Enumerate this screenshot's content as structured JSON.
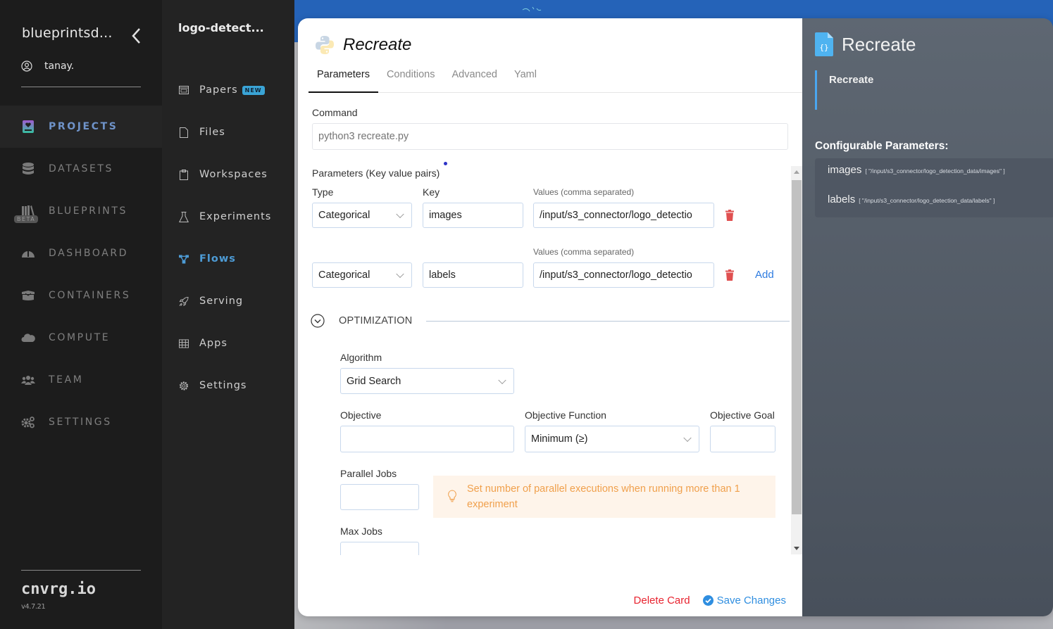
{
  "sidebar": {
    "org_name": "blueprintsd...",
    "user_name": "tanay.",
    "items": [
      {
        "label": "PROJECTS",
        "icon": "projects-icon",
        "active": true
      },
      {
        "label": "DATASETS",
        "icon": "datasets-icon"
      },
      {
        "label": "BLUEPRINTS",
        "icon": "blueprints-icon",
        "badge": "BETA"
      },
      {
        "label": "DASHBOARD",
        "icon": "dashboard-icon"
      },
      {
        "label": "CONTAINERS",
        "icon": "containers-icon"
      },
      {
        "label": "COMPUTE",
        "icon": "compute-icon"
      },
      {
        "label": "TEAM",
        "icon": "team-icon"
      },
      {
        "label": "SETTINGS",
        "icon": "settings-icon"
      }
    ],
    "brand": "cnvrg.io",
    "version": "v4.7.21"
  },
  "project_nav": {
    "title": "logo-detect...",
    "items": [
      {
        "label": "Papers",
        "icon": "papers-icon",
        "badge": "NEW"
      },
      {
        "label": "Files",
        "icon": "file-icon"
      },
      {
        "label": "Workspaces",
        "icon": "clipboard-icon"
      },
      {
        "label": "Experiments",
        "icon": "flask-icon"
      },
      {
        "label": "Flows",
        "icon": "flows-icon",
        "active": true
      },
      {
        "label": "Serving",
        "icon": "rocket-icon"
      },
      {
        "label": "Apps",
        "icon": "grid-icon"
      },
      {
        "label": "Settings",
        "icon": "gear-icon"
      }
    ]
  },
  "card": {
    "title": "Recreate",
    "tabs": [
      "Parameters",
      "Conditions",
      "Advanced",
      "Yaml"
    ],
    "active_tab": "Parameters",
    "command_label": "Command",
    "command_placeholder": "python3 recreate.py",
    "params_label": "Parameters (Key value pairs)",
    "type_label": "Type",
    "key_label": "Key",
    "values_label": "Values (comma separated)",
    "params": [
      {
        "type": "Categorical",
        "key": "images",
        "value": "/input/s3_connector/logo_detectio"
      },
      {
        "type": "Categorical",
        "key": "labels",
        "value": "/input/s3_connector/logo_detectio"
      }
    ],
    "add_label": "Add",
    "optimization": {
      "section_label": "OPTIMIZATION",
      "algorithm_label": "Algorithm",
      "algorithm_value": "Grid Search",
      "objective_label": "Objective",
      "objective_value": "",
      "objective_function_label": "Objective Function",
      "objective_function_value": "Minimum (≥)",
      "objective_goal_label": "Objective Goal",
      "objective_goal_value": "",
      "parallel_jobs_label": "Parallel Jobs",
      "parallel_jobs_value": "",
      "hint": "Set number of parallel executions when running more than 1 experiment",
      "max_jobs_label": "Max Jobs",
      "max_jobs_value": ""
    },
    "delete_label": "Delete Card",
    "save_label": "Save Changes"
  },
  "info": {
    "title": "Recreate",
    "subtitle": "Recreate",
    "configurable_title": "Configurable Parameters:",
    "params": [
      {
        "key": "images",
        "value": "[ \"/input/s3_connector/logo_detection_data/images\" ]"
      },
      {
        "key": "labels",
        "value": "[ \"/input/s3_connector/logo_detection_data/labels\" ]"
      }
    ]
  },
  "colors": {
    "accent": "#4d9bd5",
    "projects_active": "#6f93c9",
    "danger": "#e8232f",
    "link": "#2d7be0",
    "hint_text": "#f0a04c",
    "hint_bg": "#fef4ea",
    "topbar": "#2563b8"
  }
}
